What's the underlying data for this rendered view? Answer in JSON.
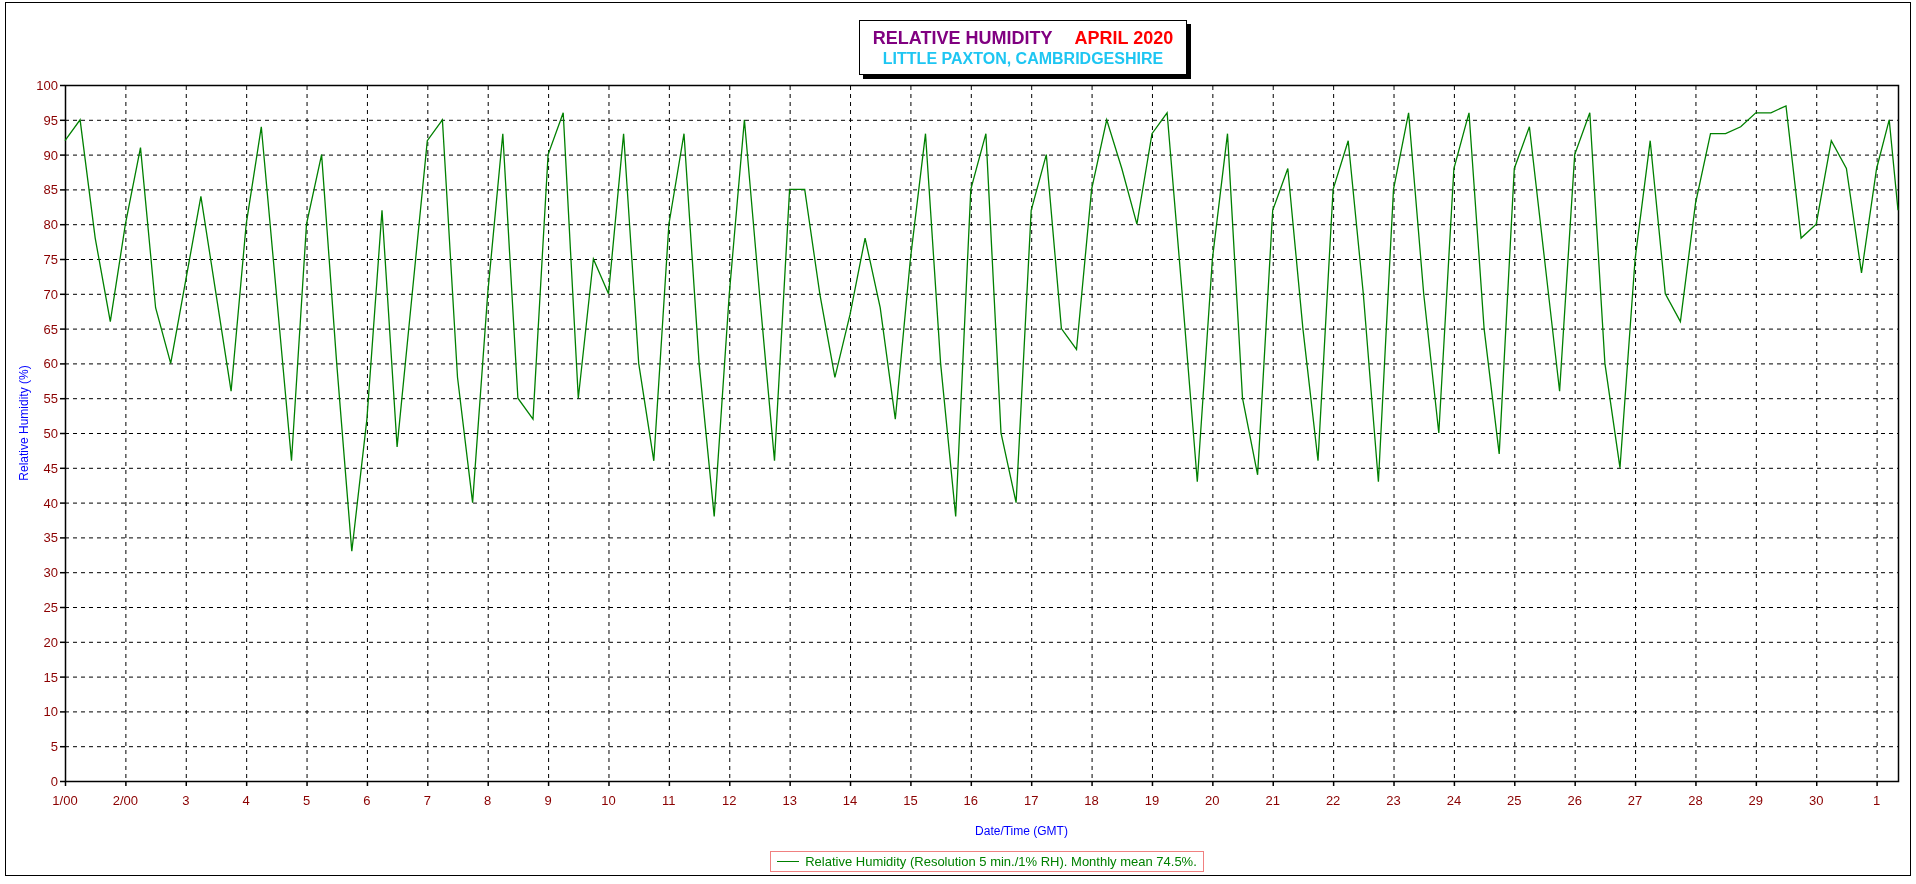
{
  "title_box": {
    "title": "RELATIVE HUMIDITY",
    "period": "APRIL 2020",
    "location": "LITTLE PAXTON, CAMBRIDGESHIRE"
  },
  "chart": {
    "chart_data": {
      "type": "line",
      "xlabel": "Date/Time (GMT)",
      "ylabel": "Relative Humidity (%)",
      "grid": true,
      "x": [
        "2020-04-01T00:00",
        "2020-04-01T06:00",
        "2020-04-01T12:00",
        "2020-04-01T18:00",
        "2020-04-02T00:00",
        "2020-04-02T06:00",
        "2020-04-02T12:00",
        "2020-04-02T18:00",
        "2020-04-03T00:00",
        "2020-04-03T06:00",
        "2020-04-03T12:00",
        "2020-04-03T18:00",
        "2020-04-04T00:00",
        "2020-04-04T06:00",
        "2020-04-04T12:00",
        "2020-04-04T18:00",
        "2020-04-05T00:00",
        "2020-04-05T06:00",
        "2020-04-05T12:00",
        "2020-04-05T18:00",
        "2020-04-06T00:00",
        "2020-04-06T06:00",
        "2020-04-06T12:00",
        "2020-04-06T18:00",
        "2020-04-07T00:00",
        "2020-04-07T06:00",
        "2020-04-07T12:00",
        "2020-04-07T18:00",
        "2020-04-08T00:00",
        "2020-04-08T06:00",
        "2020-04-08T12:00",
        "2020-04-08T18:00",
        "2020-04-09T00:00",
        "2020-04-09T06:00",
        "2020-04-09T12:00",
        "2020-04-09T18:00",
        "2020-04-10T00:00",
        "2020-04-10T06:00",
        "2020-04-10T12:00",
        "2020-04-10T18:00",
        "2020-04-11T00:00",
        "2020-04-11T06:00",
        "2020-04-11T12:00",
        "2020-04-11T18:00",
        "2020-04-12T00:00",
        "2020-04-12T06:00",
        "2020-04-12T12:00",
        "2020-04-12T18:00",
        "2020-04-13T00:00",
        "2020-04-13T06:00",
        "2020-04-13T12:00",
        "2020-04-13T18:00",
        "2020-04-14T00:00",
        "2020-04-14T06:00",
        "2020-04-14T12:00",
        "2020-04-14T18:00",
        "2020-04-15T00:00",
        "2020-04-15T06:00",
        "2020-04-15T12:00",
        "2020-04-15T18:00",
        "2020-04-16T00:00",
        "2020-04-16T06:00",
        "2020-04-16T12:00",
        "2020-04-16T18:00",
        "2020-04-17T00:00",
        "2020-04-17T06:00",
        "2020-04-17T12:00",
        "2020-04-17T18:00",
        "2020-04-18T00:00",
        "2020-04-18T06:00",
        "2020-04-18T12:00",
        "2020-04-18T18:00",
        "2020-04-19T00:00",
        "2020-04-19T06:00",
        "2020-04-19T12:00",
        "2020-04-19T18:00",
        "2020-04-20T00:00",
        "2020-04-20T06:00",
        "2020-04-20T12:00",
        "2020-04-20T18:00",
        "2020-04-21T00:00",
        "2020-04-21T06:00",
        "2020-04-21T12:00",
        "2020-04-21T18:00",
        "2020-04-22T00:00",
        "2020-04-22T06:00",
        "2020-04-22T12:00",
        "2020-04-22T18:00",
        "2020-04-23T00:00",
        "2020-04-23T06:00",
        "2020-04-23T12:00",
        "2020-04-23T18:00",
        "2020-04-24T00:00",
        "2020-04-24T06:00",
        "2020-04-24T12:00",
        "2020-04-24T18:00",
        "2020-04-25T00:00",
        "2020-04-25T06:00",
        "2020-04-25T12:00",
        "2020-04-25T18:00",
        "2020-04-26T00:00",
        "2020-04-26T06:00",
        "2020-04-26T12:00",
        "2020-04-26T18:00",
        "2020-04-27T00:00",
        "2020-04-27T06:00",
        "2020-04-27T12:00",
        "2020-04-27T18:00",
        "2020-04-28T00:00",
        "2020-04-28T06:00",
        "2020-04-28T12:00",
        "2020-04-28T18:00",
        "2020-04-29T00:00",
        "2020-04-29T06:00",
        "2020-04-29T12:00",
        "2020-04-29T18:00",
        "2020-04-30T00:00",
        "2020-04-30T06:00",
        "2020-04-30T12:00",
        "2020-04-30T18:00",
        "2020-05-01T00:00",
        "2020-05-01T05:00",
        "2020-05-01T08:30"
      ],
      "series": [
        {
          "name": "Relative Humidity (Resolution 5 min./1% RH). Monthly mean 74.5%.",
          "color": "#008000",
          "values": [
            92,
            95,
            78,
            66,
            80,
            91,
            68,
            60,
            72,
            84,
            70,
            56,
            80,
            94,
            70,
            46,
            80,
            90,
            60,
            33,
            52,
            82,
            48,
            70,
            92,
            95,
            58,
            40,
            70,
            93,
            55,
            52,
            90,
            96,
            55,
            75,
            70,
            93,
            60,
            46,
            80,
            93,
            60,
            38,
            70,
            95,
            70,
            46,
            85,
            85,
            70,
            58,
            67,
            78,
            68,
            52,
            75,
            93,
            60,
            38,
            85,
            93,
            50,
            40,
            82,
            90,
            65,
            62,
            85,
            95,
            88,
            80,
            93,
            96,
            70,
            43,
            75,
            93,
            55,
            44,
            82,
            88,
            65,
            46,
            85,
            92,
            70,
            43,
            85,
            96,
            70,
            50,
            88,
            96,
            65,
            47,
            88,
            94,
            75,
            56,
            90,
            96,
            60,
            45,
            75,
            92,
            70,
            66,
            83,
            93,
            93,
            94,
            96,
            96,
            97,
            78,
            80,
            92,
            88,
            73,
            88,
            95,
            82
          ]
        }
      ],
      "xlim": [
        "2020-04-01T00:00",
        "2020-05-01T08:30"
      ],
      "ylim": [
        0,
        100
      ],
      "xticks": [
        {
          "value": "2020-04-01T00:00",
          "label": "1/00"
        },
        {
          "value": "2020-04-02T00:00",
          "label": "2/00"
        },
        {
          "value": "2020-04-03",
          "label": "3"
        },
        {
          "value": "2020-04-04",
          "label": "4"
        },
        {
          "value": "2020-04-05",
          "label": "5"
        },
        {
          "value": "2020-04-06",
          "label": "6"
        },
        {
          "value": "2020-04-07",
          "label": "7"
        },
        {
          "value": "2020-04-08",
          "label": "8"
        },
        {
          "value": "2020-04-09",
          "label": "9"
        },
        {
          "value": "2020-04-10",
          "label": "10"
        },
        {
          "value": "2020-04-11",
          "label": "11"
        },
        {
          "value": "2020-04-12",
          "label": "12"
        },
        {
          "value": "2020-04-13",
          "label": "13"
        },
        {
          "value": "2020-04-14",
          "label": "14"
        },
        {
          "value": "2020-04-15",
          "label": "15"
        },
        {
          "value": "2020-04-16",
          "label": "16"
        },
        {
          "value": "2020-04-17",
          "label": "17"
        },
        {
          "value": "2020-04-18",
          "label": "18"
        },
        {
          "value": "2020-04-19",
          "label": "19"
        },
        {
          "value": "2020-04-20",
          "label": "20"
        },
        {
          "value": "2020-04-21",
          "label": "21"
        },
        {
          "value": "2020-04-22",
          "label": "22"
        },
        {
          "value": "2020-04-23",
          "label": "23"
        },
        {
          "value": "2020-04-24",
          "label": "24"
        },
        {
          "value": "2020-04-25",
          "label": "25"
        },
        {
          "value": "2020-04-26",
          "label": "26"
        },
        {
          "value": "2020-04-27",
          "label": "27"
        },
        {
          "value": "2020-04-28",
          "label": "28"
        },
        {
          "value": "2020-04-29",
          "label": "29"
        },
        {
          "value": "2020-04-30",
          "label": "30"
        },
        {
          "value": "2020-05-01",
          "label": "1"
        }
      ],
      "yticks": [
        0,
        5,
        10,
        15,
        20,
        25,
        30,
        35,
        40,
        45,
        50,
        55,
        60,
        65,
        70,
        75,
        80,
        85,
        90,
        95,
        100
      ]
    }
  }
}
